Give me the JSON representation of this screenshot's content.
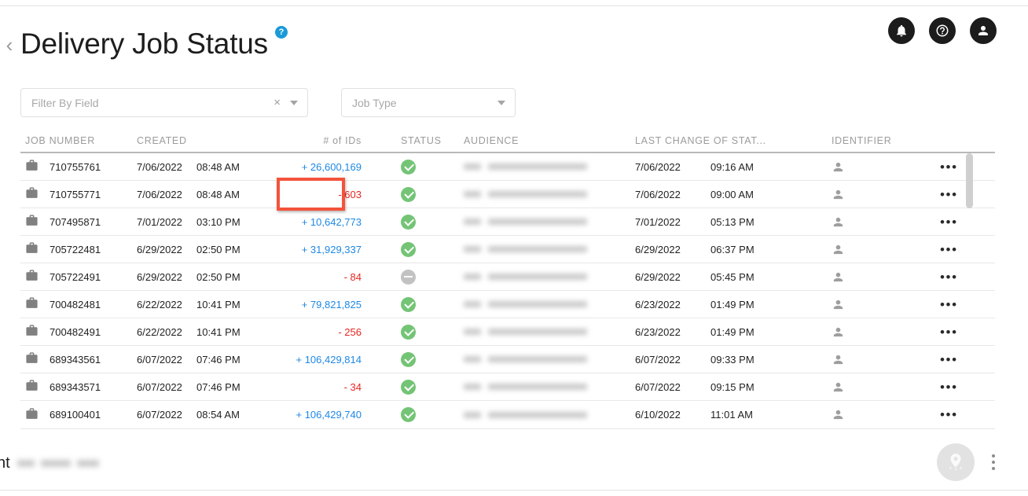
{
  "header": {
    "back_label": "‹",
    "title": "Delivery Job Status",
    "help_badge": "?",
    "icons": [
      {
        "name": "notifications-icon",
        "glyph": "bell"
      },
      {
        "name": "help-icon",
        "glyph": "question"
      },
      {
        "name": "account-icon",
        "glyph": "person"
      }
    ]
  },
  "filters": {
    "field_filter": {
      "placeholder": "Filter By Field",
      "value": "",
      "clear_label": "×"
    },
    "job_type": {
      "placeholder": "Job Type",
      "value": ""
    }
  },
  "table": {
    "columns": [
      "JOB NUMBER",
      "CREATED",
      "",
      "# of IDs",
      "STATUS",
      "AUDIENCE",
      "LAST CHANGE OF STAT...",
      "IDENTIFIER",
      ""
    ],
    "rows": [
      {
        "job_number": "710755761",
        "created_date": "7/06/2022",
        "created_time": "08:48 AM",
        "ids": "+ 26,600,169",
        "ids_sign": "pos",
        "status": "complete",
        "audience": "",
        "last_change_date": "7/06/2022",
        "last_change_time": "09:16 AM",
        "identifier": "",
        "menu": "•••"
      },
      {
        "job_number": "710755771",
        "created_date": "7/06/2022",
        "created_time": "08:48 AM",
        "ids": "- 603",
        "ids_sign": "neg",
        "status": "complete",
        "audience": "",
        "last_change_date": "7/06/2022",
        "last_change_time": "09:00 AM",
        "identifier": "",
        "menu": "•••"
      },
      {
        "job_number": "707495871",
        "created_date": "7/01/2022",
        "created_time": "03:10 PM",
        "ids": "+ 10,642,773",
        "ids_sign": "pos",
        "status": "complete",
        "audience": "",
        "last_change_date": "7/01/2022",
        "last_change_time": "05:13 PM",
        "identifier": "",
        "menu": "•••"
      },
      {
        "job_number": "705722481",
        "created_date": "6/29/2022",
        "created_time": "02:50 PM",
        "ids": "+ 31,929,337",
        "ids_sign": "pos",
        "status": "complete",
        "audience": "",
        "last_change_date": "6/29/2022",
        "last_change_time": "06:37 PM",
        "identifier": "",
        "menu": "•••"
      },
      {
        "job_number": "705722491",
        "created_date": "6/29/2022",
        "created_time": "02:50 PM",
        "ids": "- 84",
        "ids_sign": "neg",
        "status": "disabled",
        "audience": "",
        "last_change_date": "6/29/2022",
        "last_change_time": "05:45 PM",
        "identifier": "",
        "menu": "•••"
      },
      {
        "job_number": "700482481",
        "created_date": "6/22/2022",
        "created_time": "10:41 PM",
        "ids": "+ 79,821,825",
        "ids_sign": "pos",
        "status": "complete",
        "audience": "",
        "last_change_date": "6/23/2022",
        "last_change_time": "01:49 PM",
        "identifier": "",
        "menu": "•••"
      },
      {
        "job_number": "700482491",
        "created_date": "6/22/2022",
        "created_time": "10:41 PM",
        "ids": "- 256",
        "ids_sign": "neg",
        "status": "complete",
        "audience": "",
        "last_change_date": "6/23/2022",
        "last_change_time": "01:49 PM",
        "identifier": "",
        "menu": "•••"
      },
      {
        "job_number": "689343561",
        "created_date": "6/07/2022",
        "created_time": "07:46 PM",
        "ids": "+ 106,429,814",
        "ids_sign": "pos",
        "status": "complete",
        "audience": "",
        "last_change_date": "6/07/2022",
        "last_change_time": "09:33 PM",
        "identifier": "",
        "menu": "•••"
      },
      {
        "job_number": "689343571",
        "created_date": "6/07/2022",
        "created_time": "07:46 PM",
        "ids": "- 34",
        "ids_sign": "neg",
        "status": "complete",
        "audience": "",
        "last_change_date": "6/07/2022",
        "last_change_time": "09:15 PM",
        "identifier": "",
        "menu": "•••"
      },
      {
        "job_number": "689100401",
        "created_date": "6/07/2022",
        "created_time": "08:54 AM",
        "ids": "+ 106,429,740",
        "ids_sign": "pos",
        "status": "complete",
        "audience": "",
        "last_change_date": "6/10/2022",
        "last_change_time": "11:01 AM",
        "identifier": "",
        "menu": "•••"
      }
    ]
  },
  "bottom_bar": {
    "truncated_text": "nt",
    "fab_icon": "location-pin-icon",
    "overflow_menu": "vertical-dots"
  },
  "annotation": {
    "target_value": "- 603",
    "box_color": "#f4523b"
  },
  "colors": {
    "positive_ids": "#1e88e5",
    "negative_ids": "#e5261f",
    "status_complete": "#74c476",
    "status_disabled": "#c2c2c2",
    "help_badge": "#1a9ad7",
    "header_text": "#9b9b9b"
  }
}
